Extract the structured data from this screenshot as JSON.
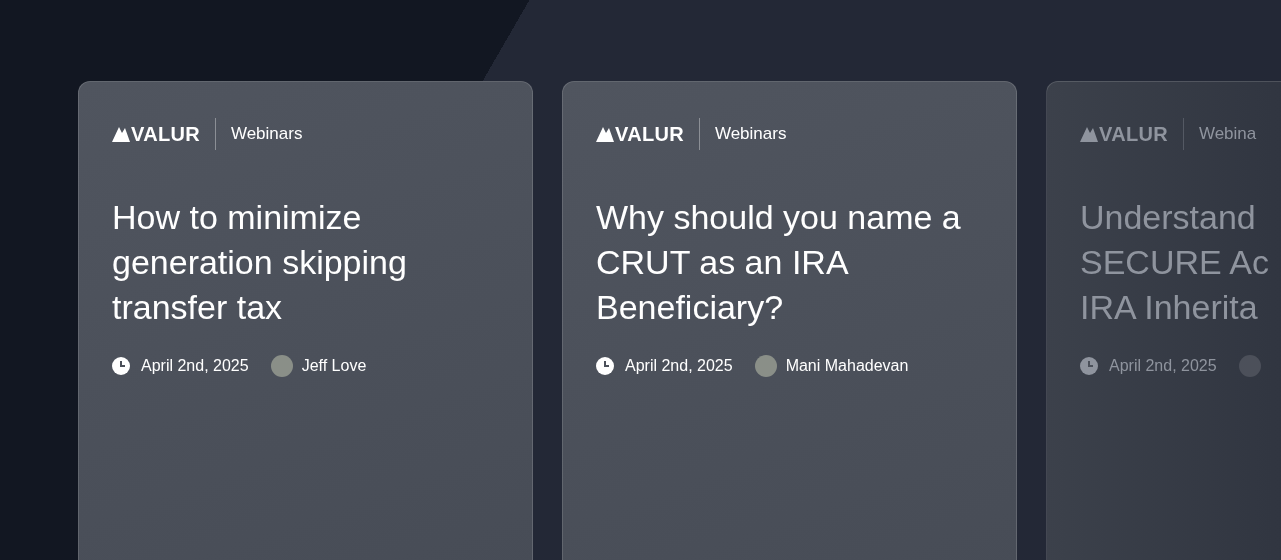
{
  "cards": [
    {
      "brand": "VALUR",
      "section": "Webinars",
      "title_lines": [
        "How to minimize",
        "generation skipping",
        "transfer tax"
      ],
      "date": "April 2nd, 2025",
      "author": "Jeff Love",
      "faded": false
    },
    {
      "brand": "VALUR",
      "section": "Webinars",
      "title_lines": [
        "Why should you name a",
        "CRUT as an IRA",
        "Beneficiary?"
      ],
      "date": "April 2nd, 2025",
      "author": "Mani Mahadevan",
      "faded": false
    },
    {
      "brand": "VALUR",
      "section": "Webina",
      "title_lines": [
        "Understand",
        "SECURE Ac",
        "IRA Inherita"
      ],
      "date": "April 2nd, 2025",
      "faded": true
    }
  ]
}
